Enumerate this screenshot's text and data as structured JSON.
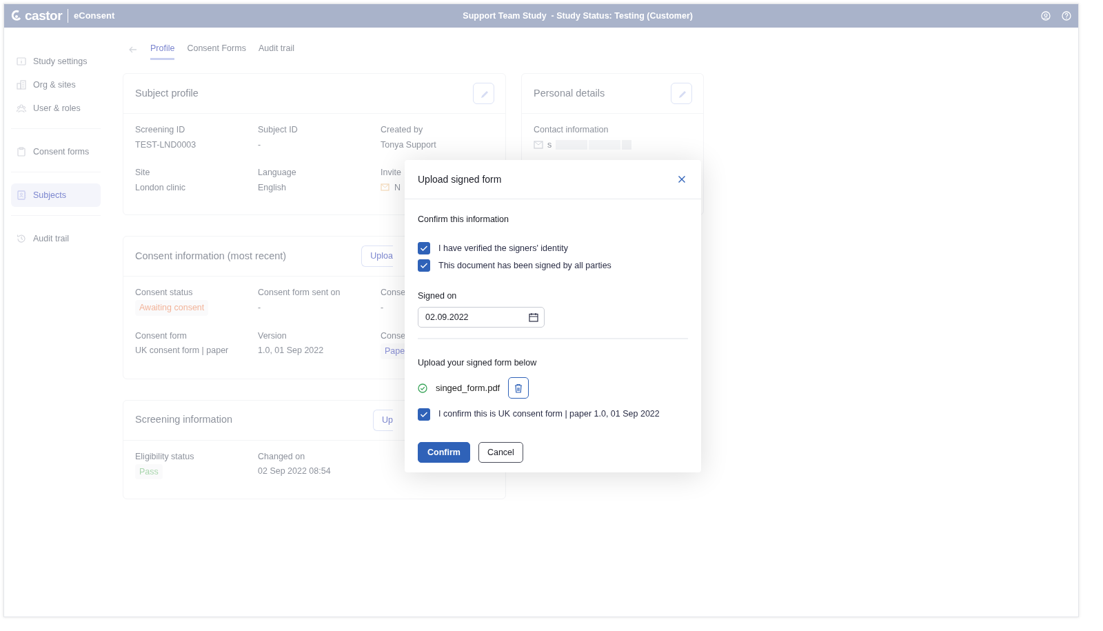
{
  "header": {
    "logo": "castor",
    "product": "eConsent",
    "title": "Support Team Study  - Study Status: Testing (Customer)"
  },
  "sidebar": {
    "sections": [
      {
        "items": [
          {
            "label": "Study settings",
            "kind": "info",
            "selected": false
          },
          {
            "label": "Org & sites",
            "kind": "building",
            "selected": false
          },
          {
            "label": "User & roles",
            "kind": "users",
            "selected": false
          }
        ]
      },
      {
        "items": [
          {
            "label": "Consent forms",
            "kind": "clipboard",
            "selected": false
          }
        ]
      },
      {
        "items": [
          {
            "label": "Subjects",
            "kind": "contacts",
            "selected": true
          }
        ]
      },
      {
        "items": [
          {
            "label": "Audit trail",
            "kind": "history",
            "selected": false
          }
        ]
      }
    ]
  },
  "tabs": [
    {
      "label": "Profile",
      "selected": true
    },
    {
      "label": "Consent Forms",
      "selected": false
    },
    {
      "label": "Audit trail",
      "selected": false
    }
  ],
  "subject_profile": {
    "title": "Subject profile",
    "fields": [
      {
        "label": "Screening ID",
        "value": "TEST-LND0003",
        "kind": "text"
      },
      {
        "label": "Subject ID",
        "value": "-",
        "kind": "text"
      },
      {
        "label": "Created by",
        "value": "Tonya Support",
        "kind": "text"
      },
      {
        "label": "Site",
        "value": "London clinic",
        "kind": "text"
      },
      {
        "label": "Language",
        "value": "English",
        "kind": "text"
      },
      {
        "label": "Invite",
        "value": "N",
        "kind": "mail"
      }
    ]
  },
  "personal_details": {
    "title": "Personal details",
    "fields": [
      {
        "label": "Contact information",
        "value": "s",
        "kind": "email"
      }
    ]
  },
  "consent_information": {
    "title": "Consent information (most recent)",
    "button": "Uploa",
    "fields": [
      {
        "label": "Consent status",
        "value": "Awaiting consent",
        "kind": "badge",
        "color": "#f2b49a"
      },
      {
        "label": "Consent form sent on",
        "value": "-",
        "kind": "text"
      },
      {
        "label": "Conse",
        "value": "-",
        "kind": "text"
      },
      {
        "label": "Consent form",
        "value": "UK consent form | paper",
        "kind": "text"
      },
      {
        "label": "Version",
        "value": "1.0, 01 Sep 2022",
        "kind": "text"
      },
      {
        "label": "Conse",
        "value": "Pape",
        "kind": "badge",
        "color": "#8a90d6"
      }
    ]
  },
  "screening_information": {
    "title": "Screening information",
    "button": "Up",
    "fields": [
      {
        "label": "Eligibility status",
        "value": "Pass",
        "kind": "badge",
        "color": "#a9d6ad"
      },
      {
        "label": "Changed on",
        "value": "02 Sep 2022 08:54",
        "kind": "text"
      }
    ]
  },
  "modal": {
    "title": "Upload signed form",
    "section_title": "Confirm this information",
    "checks": [
      {
        "label": "I have verified the signers' identity",
        "checked": true
      },
      {
        "label": "This document has been signed by all parties",
        "checked": true
      }
    ],
    "date_label": "Signed on",
    "date_value": "02.09.2022",
    "upload_label": "Upload your signed form below",
    "file_name": "singed_form.pdf",
    "confirm_check": {
      "label": "I confirm this is UK consent form | paper 1.0, 01 Sep 2022",
      "checked": true
    },
    "buttons": [
      {
        "label": "Confirm",
        "kind": "primary"
      },
      {
        "label": "Cancel",
        "kind": "secondary"
      }
    ]
  }
}
